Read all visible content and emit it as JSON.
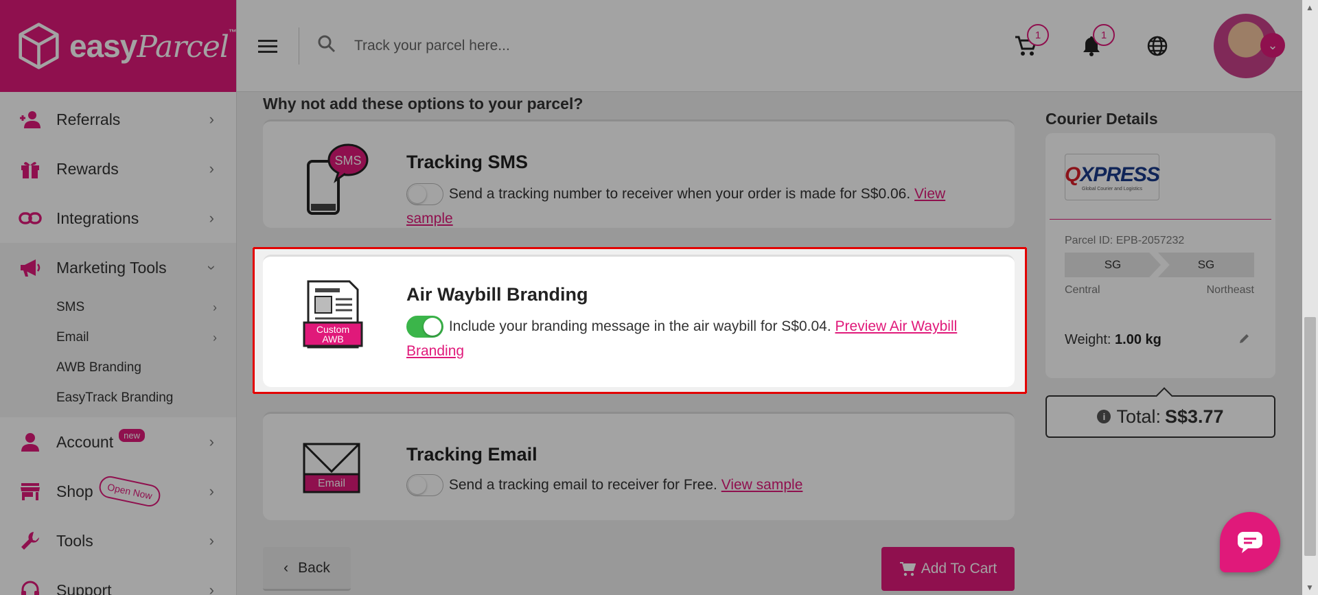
{
  "brand": {
    "name_part1": "easy",
    "name_part2": "Parcel",
    "tm": "™",
    "color": "#e0197a"
  },
  "search": {
    "placeholder": "Track your parcel here..."
  },
  "header": {
    "cart_count": "1",
    "notification_count": "1"
  },
  "sidebar": {
    "items": [
      {
        "label": "Referrals",
        "icon": "referral-icon"
      },
      {
        "label": "Rewards",
        "icon": "gift-icon"
      },
      {
        "label": "Integrations",
        "icon": "link-icon"
      },
      {
        "label": "Marketing Tools",
        "icon": "megaphone-icon"
      },
      {
        "label": "Account",
        "icon": "person-icon",
        "badge": "new"
      },
      {
        "label": "Shop",
        "icon": "store-icon",
        "badge": "Open Now"
      },
      {
        "label": "Tools",
        "icon": "wrench-icon"
      },
      {
        "label": "Support",
        "icon": "headset-icon"
      }
    ],
    "marketing_sub": [
      {
        "label": "SMS"
      },
      {
        "label": "Email"
      },
      {
        "label": "AWB Branding"
      },
      {
        "label": "EasyTrack Branding"
      }
    ]
  },
  "options": {
    "title": "Why not add these options to your parcel?",
    "sms": {
      "title": "Tracking SMS",
      "illus_label": "SMS",
      "text": "Send a tracking number to receiver when your order is made for S$0.06.",
      "link": "View sample",
      "enabled": false
    },
    "awb": {
      "title": "Air Waybill Branding",
      "illus_label_1": "Custom",
      "illus_label_2": "AWB",
      "text": "Include your branding message in the air waybill for S$0.04.",
      "link": "Preview Air Waybill Branding",
      "enabled": true
    },
    "email": {
      "title": "Tracking Email",
      "illus_label": "Email",
      "text": "Send a tracking email to receiver for Free.",
      "link": "View sample",
      "enabled": false
    }
  },
  "actions": {
    "back": "Back",
    "add_to_cart": "Add To Cart"
  },
  "courier": {
    "title": "Courier Details",
    "logo_text": "XPRESS",
    "logo_q": "Q",
    "logo_sub": "Global Courier and Logistics",
    "parcel_id": "Parcel ID: EPB-2057232",
    "from_code": "SG",
    "to_code": "SG",
    "from_label": "Central",
    "to_label": "Northeast",
    "weight_label": "Weight:",
    "weight_value": "1.00 kg",
    "total_label": "Total:",
    "total_value": "S$3.77"
  }
}
